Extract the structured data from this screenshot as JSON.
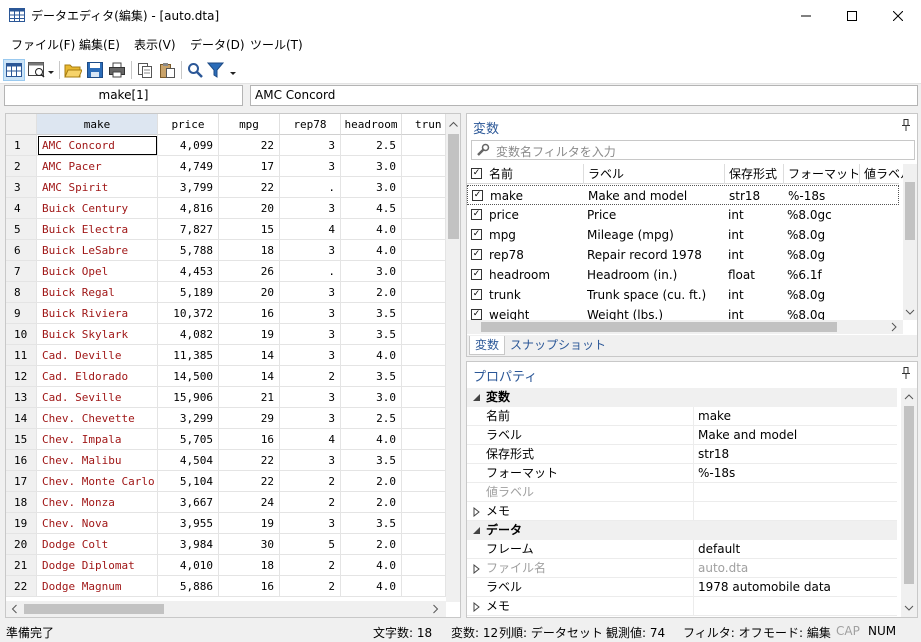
{
  "window": {
    "title": "データエディタ(編集) - [auto.dta]"
  },
  "menu": [
    "ファイル(F)",
    "編集(E)",
    "表示(V)",
    "データ(D)",
    "ツール(T)"
  ],
  "toolbar": {
    "icons": [
      "edit-mode-icon",
      "browse-mode-icon",
      "open-icon",
      "save-icon",
      "print-icon",
      "copy-icon",
      "paste-icon",
      "find-icon",
      "filter-icon"
    ]
  },
  "cell_ref": {
    "varname": "make[1]",
    "value": "AMC Concord"
  },
  "grid": {
    "columns": [
      "make",
      "price",
      "mpg",
      "rep78",
      "headroom",
      "trun"
    ],
    "rows": [
      [
        "1",
        "AMC Concord",
        "4,099",
        "22",
        "3",
        "2.5"
      ],
      [
        "2",
        "AMC Pacer",
        "4,749",
        "17",
        "3",
        "3.0"
      ],
      [
        "3",
        "AMC Spirit",
        "3,799",
        "22",
        ".",
        "3.0"
      ],
      [
        "4",
        "Buick Century",
        "4,816",
        "20",
        "3",
        "4.5"
      ],
      [
        "5",
        "Buick Electra",
        "7,827",
        "15",
        "4",
        "4.0"
      ],
      [
        "6",
        "Buick LeSabre",
        "5,788",
        "18",
        "3",
        "4.0"
      ],
      [
        "7",
        "Buick Opel",
        "4,453",
        "26",
        ".",
        "3.0"
      ],
      [
        "8",
        "Buick Regal",
        "5,189",
        "20",
        "3",
        "2.0"
      ],
      [
        "9",
        "Buick Riviera",
        "10,372",
        "16",
        "3",
        "3.5"
      ],
      [
        "10",
        "Buick Skylark",
        "4,082",
        "19",
        "3",
        "3.5"
      ],
      [
        "11",
        "Cad. Deville",
        "11,385",
        "14",
        "3",
        "4.0"
      ],
      [
        "12",
        "Cad. Eldorado",
        "14,500",
        "14",
        "2",
        "3.5"
      ],
      [
        "13",
        "Cad. Seville",
        "15,906",
        "21",
        "3",
        "3.0"
      ],
      [
        "14",
        "Chev. Chevette",
        "3,299",
        "29",
        "3",
        "2.5"
      ],
      [
        "15",
        "Chev. Impala",
        "5,705",
        "16",
        "4",
        "4.0"
      ],
      [
        "16",
        "Chev. Malibu",
        "4,504",
        "22",
        "3",
        "3.5"
      ],
      [
        "17",
        "Chev. Monte Carlo",
        "5,104",
        "22",
        "2",
        "2.0"
      ],
      [
        "18",
        "Chev. Monza",
        "3,667",
        "24",
        "2",
        "2.0"
      ],
      [
        "19",
        "Chev. Nova",
        "3,955",
        "19",
        "3",
        "3.5"
      ],
      [
        "20",
        "Dodge Colt",
        "3,984",
        "30",
        "5",
        "2.0"
      ],
      [
        "21",
        "Dodge Diplomat",
        "4,010",
        "18",
        "2",
        "4.0"
      ],
      [
        "22",
        "Dodge Magnum",
        "5,886",
        "16",
        "2",
        "4.0"
      ]
    ]
  },
  "variables_panel": {
    "title": "変数",
    "filter_placeholder": "変数名フィルタを入力",
    "headers": [
      "名前",
      "ラベル",
      "保存形式",
      "フォーマット",
      "値ラベル"
    ],
    "rows": [
      [
        "make",
        "Make and model",
        "str18",
        "%-18s"
      ],
      [
        "price",
        "Price",
        "int",
        "%8.0gc"
      ],
      [
        "mpg",
        "Mileage (mpg)",
        "int",
        "%8.0g"
      ],
      [
        "rep78",
        "Repair record 1978",
        "int",
        "%8.0g"
      ],
      [
        "headroom",
        "Headroom (in.)",
        "float",
        "%6.1f"
      ],
      [
        "trunk",
        "Trunk space (cu. ft.)",
        "int",
        "%8.0g"
      ],
      [
        "weight",
        "Weight (lbs.)",
        "int",
        "%8.0g"
      ]
    ],
    "tabs": [
      "変数",
      "スナップショット"
    ]
  },
  "properties_panel": {
    "title": "プロパティ",
    "sections": [
      {
        "name": "変数",
        "rows": [
          [
            "名前",
            "make"
          ],
          [
            "ラベル",
            "Make and model"
          ],
          [
            "保存形式",
            "str18"
          ],
          [
            "フォーマット",
            "%-18s"
          ],
          [
            "値ラベル",
            ""
          ],
          [
            "メモ",
            ""
          ]
        ]
      },
      {
        "name": "データ",
        "rows": [
          [
            "フレーム",
            "default"
          ],
          [
            "ファイル名",
            "auto.dta"
          ],
          [
            "ラベル",
            "1978 automobile data"
          ],
          [
            "メモ",
            ""
          ]
        ]
      }
    ]
  },
  "status": {
    "ready": "準備完了",
    "chars": "文字数: 18",
    "vars": "変数: 12",
    "order": "列順: データセット",
    "obs": "観測値: 74",
    "filter": "フィルタ: オフ",
    "mode": "モード: 編集",
    "cap": "CAP",
    "num": "NUM"
  },
  "colors": {
    "string_value": "#a01818",
    "panel_title": "#2b5797",
    "row_number_bg": "#f0f0f0"
  }
}
